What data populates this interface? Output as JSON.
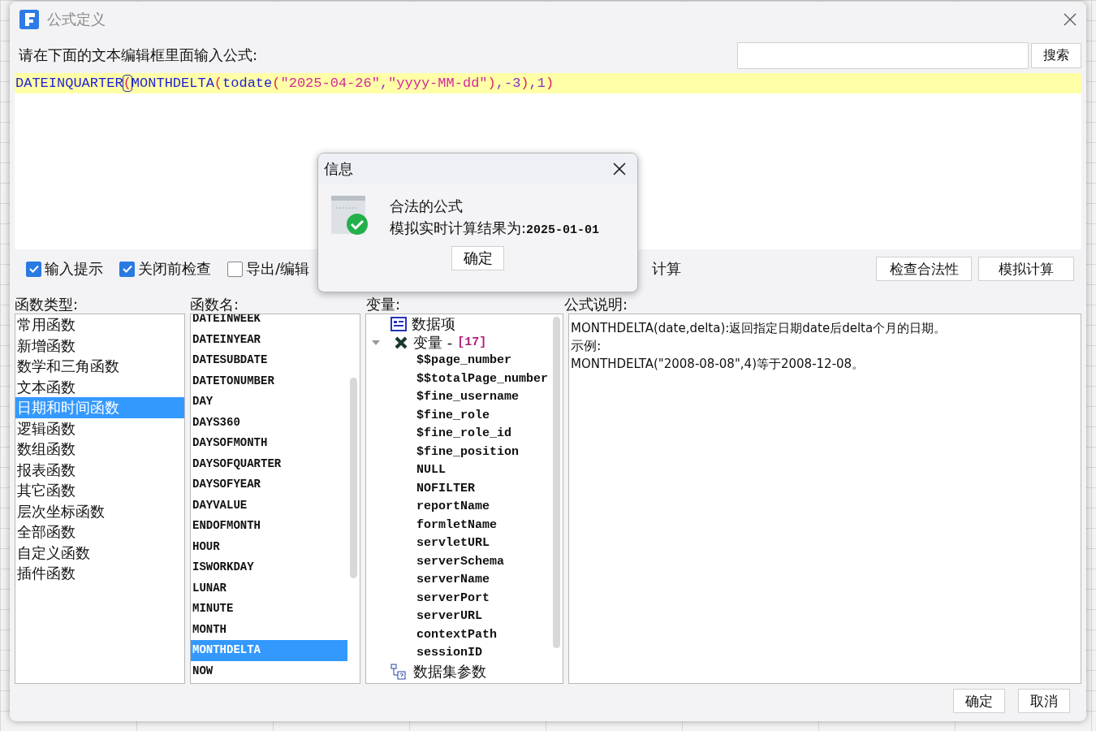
{
  "window": {
    "title": "公式定义"
  },
  "prompt": "请在下面的文本编辑框里面输入公式:",
  "search": {
    "button": "搜索"
  },
  "formula": [
    {
      "kind": "func",
      "text": "DATEINQUARTER"
    },
    {
      "kind": "paren",
      "text": "(",
      "caret": true
    },
    {
      "kind": "func",
      "text": "MONTHDELTA"
    },
    {
      "kind": "paren",
      "text": "("
    },
    {
      "kind": "func",
      "text": "todate"
    },
    {
      "kind": "paren",
      "text": "("
    },
    {
      "kind": "string",
      "text": "\"2025-04-26\""
    },
    {
      "kind": "punct",
      "text": ","
    },
    {
      "kind": "string",
      "text": "\"yyyy-MM-dd\""
    },
    {
      "kind": "paren",
      "text": ")"
    },
    {
      "kind": "punct",
      "text": ",-3"
    },
    {
      "kind": "paren",
      "text": ")"
    },
    {
      "kind": "punct",
      "text": ",1"
    },
    {
      "kind": "paren",
      "text": ")"
    }
  ],
  "options": [
    {
      "label": "输入提示",
      "checked": true
    },
    {
      "label": "关闭前检查",
      "checked": true
    },
    {
      "label": "导出/编辑",
      "checked": false
    }
  ],
  "option_partial": "计算",
  "actions": [
    "检查合法性",
    "模拟计算"
  ],
  "function_types": {
    "label": "函数类型:",
    "items": [
      {
        "text": "常用函数",
        "selected": false
      },
      {
        "text": "新增函数",
        "selected": false
      },
      {
        "text": "数学和三角函数",
        "selected": false
      },
      {
        "text": "文本函数",
        "selected": false
      },
      {
        "text": "日期和时间函数",
        "selected": true
      },
      {
        "text": "逻辑函数",
        "selected": false
      },
      {
        "text": "数组函数",
        "selected": false
      },
      {
        "text": "报表函数",
        "selected": false
      },
      {
        "text": "其它函数",
        "selected": false
      },
      {
        "text": "层次坐标函数",
        "selected": false
      },
      {
        "text": "全部函数",
        "selected": false
      },
      {
        "text": "自定义函数",
        "selected": false
      },
      {
        "text": "插件函数",
        "selected": false
      }
    ]
  },
  "function_names": {
    "label": "函数名:",
    "items": [
      {
        "text": "DATEINWEEK",
        "selected": false
      },
      {
        "text": "DATEINYEAR",
        "selected": false
      },
      {
        "text": "DATESUBDATE",
        "selected": false
      },
      {
        "text": "DATETONUMBER",
        "selected": false
      },
      {
        "text": "DAY",
        "selected": false
      },
      {
        "text": "DAYS360",
        "selected": false
      },
      {
        "text": "DAYSOFMONTH",
        "selected": false
      },
      {
        "text": "DAYSOFQUARTER",
        "selected": false
      },
      {
        "text": "DAYSOFYEAR",
        "selected": false
      },
      {
        "text": "DAYVALUE",
        "selected": false
      },
      {
        "text": "ENDOFMONTH",
        "selected": false
      },
      {
        "text": "HOUR",
        "selected": false
      },
      {
        "text": "ISWORKDAY",
        "selected": false
      },
      {
        "text": "LUNAR",
        "selected": false
      },
      {
        "text": "MINUTE",
        "selected": false
      },
      {
        "text": "MONTH",
        "selected": false
      },
      {
        "text": "MONTHDELTA",
        "selected": true
      },
      {
        "text": "NOW",
        "selected": false
      }
    ]
  },
  "variables": {
    "label": "变量:",
    "tree": [
      {
        "kind": "dataitem",
        "label": "数据项",
        "expanded": false
      },
      {
        "kind": "variable",
        "label": "变量 -",
        "count": "[17]",
        "expanded": true,
        "children": [
          {
            "label": "$$page_number"
          },
          {
            "label": "$$totalPage_number"
          },
          {
            "label": "$fine_username"
          },
          {
            "label": "$fine_role"
          },
          {
            "label": "$fine_role_id"
          },
          {
            "label": "$fine_position"
          },
          {
            "label": "NULL"
          },
          {
            "label": "NOFILTER"
          },
          {
            "label": "reportName"
          },
          {
            "label": "formletName"
          },
          {
            "label": "servletURL"
          },
          {
            "label": "serverSchema"
          },
          {
            "label": "serverName"
          },
          {
            "label": "serverPort"
          },
          {
            "label": "serverURL"
          },
          {
            "label": "contextPath"
          },
          {
            "label": "sessionID"
          }
        ]
      },
      {
        "kind": "dataset",
        "label": "数据集参数",
        "expanded": false
      }
    ]
  },
  "description": {
    "label": "公式说明:",
    "lines": [
      "MONTHDELTA(date,delta):返回指定日期date后delta个月的日期。",
      "示例:",
      "MONTHDELTA(\"2008-08-08\",4)等于2008-12-08。"
    ]
  },
  "footer_buttons": [
    "确定",
    "取消"
  ],
  "info_dialog": {
    "title": "信息",
    "message": "合法的公式",
    "result_label": "模拟实时计算结果为:",
    "result_value": "2025-01-01",
    "button": "确定"
  }
}
